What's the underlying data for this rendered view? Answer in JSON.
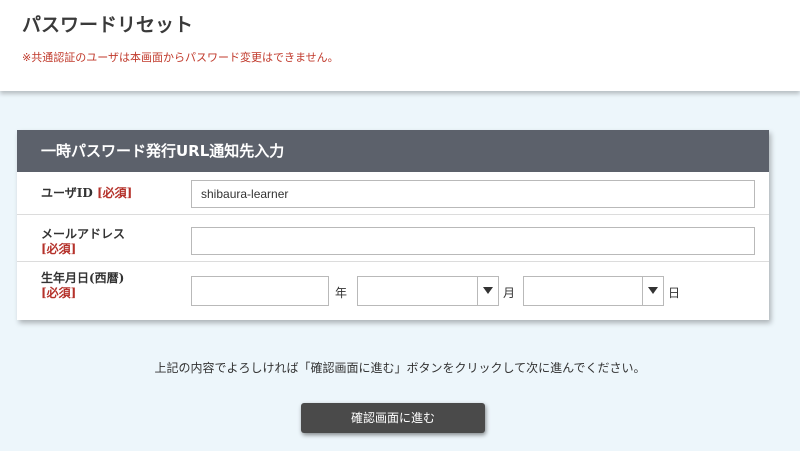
{
  "page": {
    "title": "パスワードリセット",
    "notice": "※共通認証のユーザは本画面からパスワード変更はできません。"
  },
  "form": {
    "header": "一時パスワード発行URL通知先入力",
    "user_id": {
      "label": "ユーザID",
      "required": "[必須]",
      "value": "shibaura-learner"
    },
    "email": {
      "label": "メールアドレス",
      "required": "[必須]",
      "value": ""
    },
    "birthdate": {
      "label": "生年月日(西暦)",
      "required": "[必須]",
      "year_value": "",
      "year_unit": "年",
      "month_selected": "",
      "month_unit": "月",
      "day_selected": "",
      "day_unit": "日"
    }
  },
  "instruction": "上記の内容でよろしければ「確認画面に進む」ボタンをクリックして次に進んでください。",
  "confirm_button": "確認画面に進む"
}
